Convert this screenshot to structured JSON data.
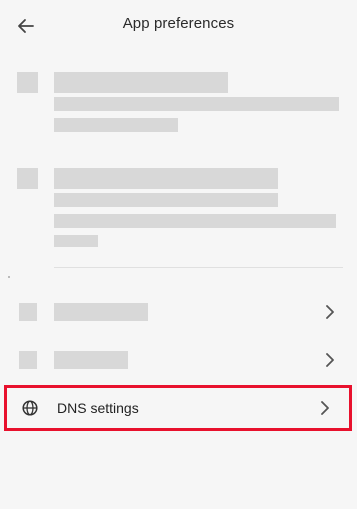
{
  "header": {
    "title": "App preferences",
    "back_icon": "arrow-left-icon"
  },
  "rows": {
    "dns": {
      "label": "DNS settings",
      "icon": "globe-icon",
      "chevron": "chevron-right-icon",
      "highlight_color": "#e8112d"
    }
  }
}
